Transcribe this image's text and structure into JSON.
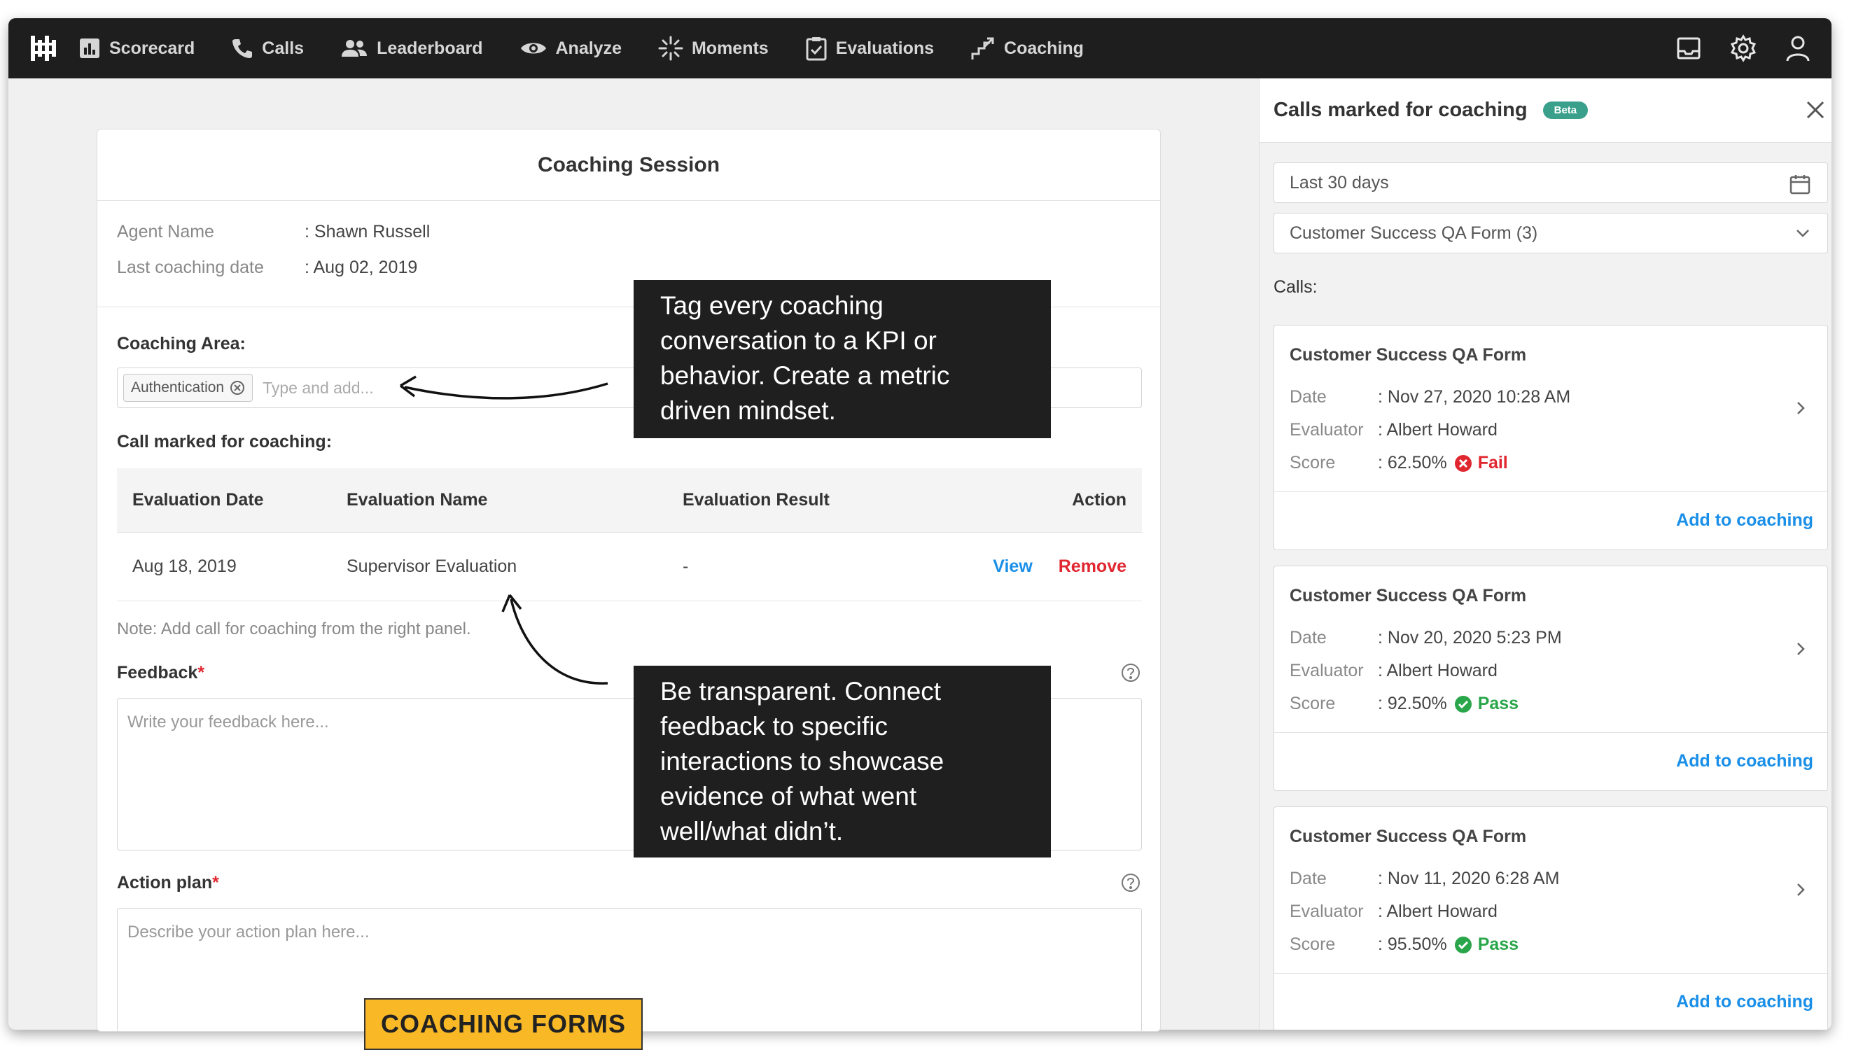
{
  "nav": {
    "items": [
      {
        "label": "Scorecard",
        "icon": "scorecard-icon"
      },
      {
        "label": "Calls",
        "icon": "phone-icon"
      },
      {
        "label": "Leaderboard",
        "icon": "users-icon"
      },
      {
        "label": "Analyze",
        "icon": "eye-icon"
      },
      {
        "label": "Moments",
        "icon": "sparkle-icon"
      },
      {
        "label": "Evaluations",
        "icon": "clipboard-check-icon"
      },
      {
        "label": "Coaching",
        "icon": "coaching-icon"
      }
    ]
  },
  "session": {
    "title": "Coaching Session",
    "agent_label": "Agent Name",
    "agent_value": ": Shawn Russell",
    "date_label": "Last coaching date",
    "date_value": ": Aug 02, 2019",
    "area_label": "Coaching Area:",
    "tag": "Authentication",
    "tag_placeholder": "Type and add...",
    "call_marked_label": "Call marked for coaching:",
    "table": {
      "headers": [
        "Evaluation Date",
        "Evaluation Name",
        "Evaluation Result",
        "Action"
      ],
      "row": {
        "date": "Aug 18, 2019",
        "name": "Supervisor Evaluation",
        "result": "-",
        "view": "View",
        "remove": "Remove"
      }
    },
    "note": "Note: Add call for coaching from the right panel.",
    "feedback_label": "Feedback",
    "feedback_placeholder": "Write your feedback here...",
    "action_label": "Action plan",
    "action_placeholder": "Describe your action plan here...",
    "required_mark": "*"
  },
  "callouts": {
    "top": "Tag every coaching conversation to a KPI or behavior. Create a metric driven mindset.",
    "bottom": "Be transparent. Connect feedback to specific interactions to showcase evidence of what went well/what didn’t."
  },
  "badge": "COACHING FORMS",
  "panel": {
    "title": "Calls marked for coaching",
    "beta": "Beta",
    "date_range": "Last 30 days",
    "form_select": "Customer Success QA Form (3)",
    "calls_label": "Calls:",
    "field_labels": {
      "date": "Date",
      "evaluator": "Evaluator",
      "score": "Score"
    },
    "add_label": "Add to coaching",
    "cards": [
      {
        "title": "Customer Success QA Form",
        "date": ": Nov 27, 2020 10:28 AM",
        "evaluator": ": Albert Howard",
        "score": ": 62.50%",
        "status": "Fail",
        "status_color": "#e0262f"
      },
      {
        "title": "Customer Success QA Form",
        "date": ": Nov 20, 2020 5:23 PM",
        "evaluator": ": Albert Howard",
        "score": ": 92.50%",
        "status": "Pass",
        "status_color": "#2aa64a"
      },
      {
        "title": "Customer Success QA Form",
        "date": ": Nov 11, 2020 6:28 AM",
        "evaluator": ": Albert Howard",
        "score": ": 95.50%",
        "status": "Pass",
        "status_color": "#2aa64a"
      }
    ]
  }
}
